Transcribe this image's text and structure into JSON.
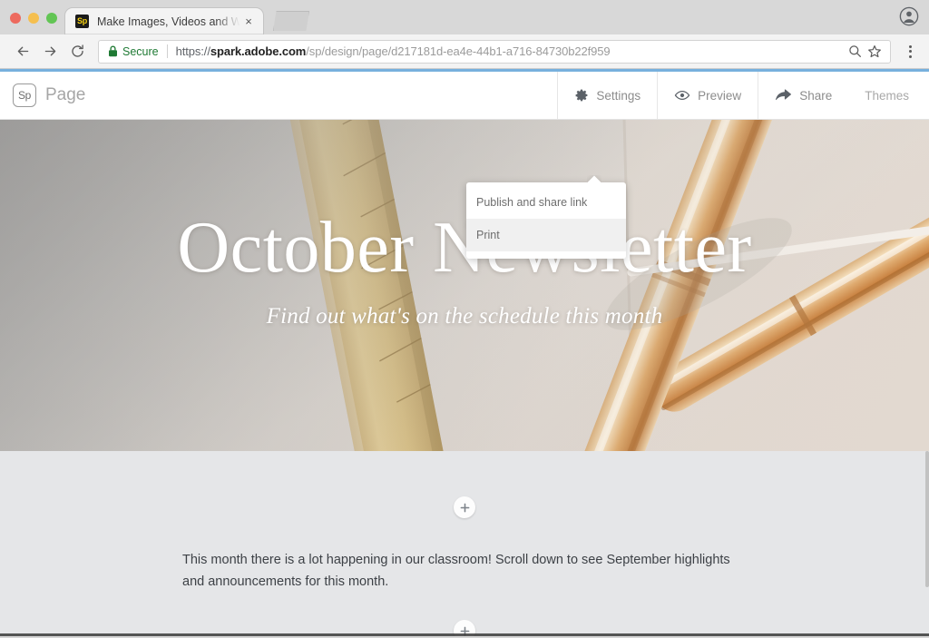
{
  "browser": {
    "window_controls": [
      "close",
      "minimize",
      "maximize"
    ],
    "tab": {
      "favicon_text": "Sp",
      "title": "Make Images, Videos and Web",
      "close_label": "×"
    },
    "new_tab_label": "+",
    "nav": {
      "back": "←",
      "forward": "→",
      "reload": "⟳"
    },
    "omnibox": {
      "security_label": "Secure",
      "url_scheme": "https://",
      "url_domain": "spark.adobe.com",
      "url_path": "/sp/design/page/d217181d-ea4e-44b1-a716-84730b22f959",
      "search_icon": "search-icon",
      "bookmark_icon": "star-icon"
    },
    "menu_icon": "kebab-menu-icon",
    "profile_icon": "account-avatar-icon"
  },
  "app": {
    "logo_text": "Sp",
    "page_name": "Page",
    "toolbar": [
      {
        "label": "Settings",
        "icon": "gear-icon"
      },
      {
        "label": "Preview",
        "icon": "eye-icon"
      },
      {
        "label": "Share",
        "icon": "share-arrow-icon"
      }
    ],
    "themes_label": "Themes",
    "share_menu": {
      "items": [
        {
          "label": "Publish and share link",
          "highlighted": false
        },
        {
          "label": "Print",
          "highlighted": true
        }
      ]
    },
    "hero": {
      "title": "October Newsletter",
      "subtitle": "Find out what's on the schedule this month"
    },
    "content": {
      "add_button_label": "+",
      "paragraph": "This month there is a lot happening in our classroom! Scroll down to see September highlights and announcements for this month."
    }
  },
  "colors": {
    "secure_green": "#1f7a34",
    "loading_blue": "#77b0dd",
    "section_bg": "#e5e6e8",
    "favicon_yellow": "#f5d010"
  }
}
